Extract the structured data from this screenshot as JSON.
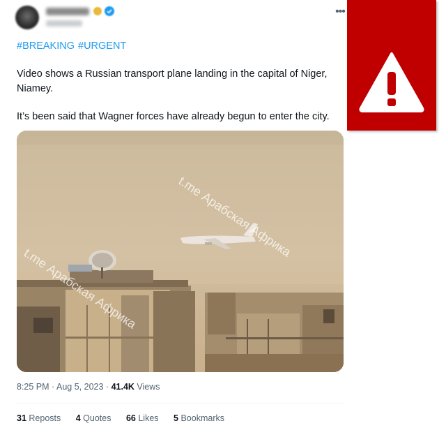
{
  "tweet": {
    "hashtags": [
      "#BREAKING",
      "#URGENT"
    ],
    "text_line1": "Video shows a Russian transport plane landing in the capital of Niger, Niamey.",
    "text_line2": "It’s been said that Wagner forces have already begun to enter the city.",
    "media": {
      "watermark1": "t.me Арабская Африка",
      "watermark2": "t.me Арабская Африка"
    },
    "meta": {
      "time": "8:25 PM",
      "date": "Aug 5, 2023",
      "separator": "·",
      "views_count": "41.4K",
      "views_label": "Views"
    },
    "stats": {
      "reposts_count": "31",
      "reposts_label": "Reposts",
      "quotes_count": "4",
      "quotes_label": "Quotes",
      "likes_count": "66",
      "likes_label": "Likes",
      "bookmarks_count": "5",
      "bookmarks_label": "Bookmarks"
    },
    "icons": [
      "more-icon",
      "verified-icon",
      "gold-badge-icon",
      "warning-icon"
    ],
    "colors": {
      "link": "#1d9bf0",
      "text": "#0f1419",
      "secondary": "#536471",
      "warning_bg": "#c00000"
    }
  }
}
